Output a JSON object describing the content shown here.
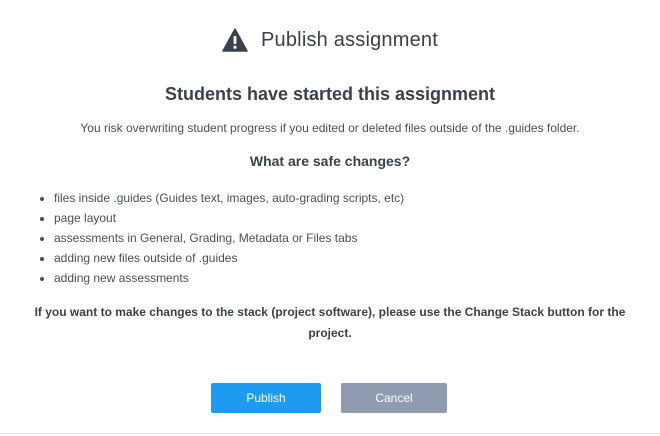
{
  "dialog": {
    "title": "Publish assignment",
    "icon": "warning-icon",
    "heading": "Students have started this assignment",
    "risk_text": "You risk overwriting student progress if you edited or deleted files outside of the .guides folder.",
    "safe_heading": "What are safe changes?",
    "safe_changes": [
      "files inside .guides (Guides text, images, auto-grading scripts, etc)",
      "page layout",
      "assessments in General, Grading, Metadata or Files tabs",
      "adding new files outside of .guides",
      "adding new assessments"
    ],
    "stack_note": "If you want to make changes to the stack (project software), please use the Change Stack button for the project.",
    "buttons": {
      "publish_label": "Publish",
      "cancel_label": "Cancel"
    }
  },
  "colors": {
    "publish": "#1d9bf0",
    "cancel": "#8f9bb1",
    "text": "#3b414a"
  }
}
